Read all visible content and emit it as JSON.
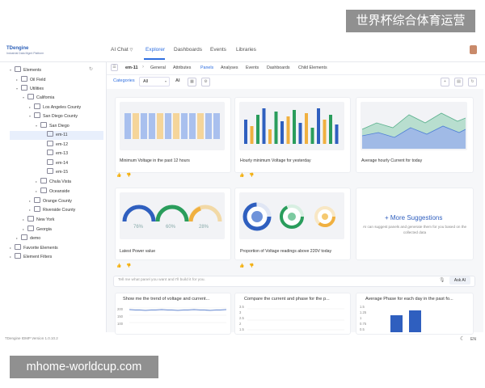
{
  "brand_banner": "世界杯综合体育运营",
  "url_banner": "mhome-worldcup.com",
  "header": {
    "logo_line1": "TDengine",
    "logo_line2": "Industrial Data Mgmt Platform",
    "nav": [
      "AI Chat",
      "Explorer",
      "Dashboards",
      "Events",
      "Libraries"
    ],
    "active_nav": "Explorer"
  },
  "sidebar": {
    "items": [
      {
        "label": "Elements",
        "level": 0,
        "caret": "▾"
      },
      {
        "label": "Oil Field",
        "level": 1,
        "caret": "▸"
      },
      {
        "label": "Utilities",
        "level": 1,
        "caret": "▾"
      },
      {
        "label": "California",
        "level": 2,
        "caret": "▾"
      },
      {
        "label": "Los Angeles County",
        "level": 3,
        "caret": "▸"
      },
      {
        "label": "San Diego County",
        "level": 3,
        "caret": "▾"
      },
      {
        "label": "San Diego",
        "level": 4,
        "caret": "▾"
      },
      {
        "label": "em-11",
        "level": 5,
        "caret": ""
      },
      {
        "label": "em-12",
        "level": 5,
        "caret": ""
      },
      {
        "label": "em-13",
        "level": 5,
        "caret": ""
      },
      {
        "label": "em-14",
        "level": 5,
        "caret": ""
      },
      {
        "label": "em-15",
        "level": 5,
        "caret": ""
      },
      {
        "label": "Chula Vista",
        "level": 4,
        "caret": "▸"
      },
      {
        "label": "Oceanside",
        "level": 4,
        "caret": "▸"
      },
      {
        "label": "Orange County",
        "level": 3,
        "caret": "▸"
      },
      {
        "label": "Riverside County",
        "level": 3,
        "caret": "▸"
      },
      {
        "label": "New York",
        "level": 2,
        "caret": "▸"
      },
      {
        "label": "Georgia",
        "level": 2,
        "caret": "▸"
      },
      {
        "label": "demo",
        "level": 1,
        "caret": "▸"
      },
      {
        "label": "Favorite Elements",
        "level": 0,
        "caret": "▸"
      },
      {
        "label": "Element Filters",
        "level": 0,
        "caret": "▸"
      }
    ],
    "selected": "em-11"
  },
  "breadcrumb": "em-11",
  "tabs": [
    "General",
    "Attributes",
    "Panels",
    "Analyses",
    "Events",
    "Dashboards",
    "Child Elements"
  ],
  "active_tab": "Panels",
  "toolbar": {
    "categories": "Categories",
    "filter": "All",
    "ai": "AI"
  },
  "panels": [
    {
      "title": "Minimum Voltage in the past 12 hours"
    },
    {
      "title": "Hourly minimum Voltage for yesterday"
    },
    {
      "title": "Average hourly Current for today"
    },
    {
      "title": "Latest Power value"
    },
    {
      "title": "Proportion of Voltage readings above 220V today"
    }
  ],
  "gauges": [
    "76%",
    "60%",
    "28%"
  ],
  "suggestions": {
    "title": "+ More Suggestions",
    "desc": "AI can suggest panels and generate them for you based on the collected data"
  },
  "ask": {
    "placeholder": "Tell me what panel you want and I'll build it for you.",
    "button": "Ask AI"
  },
  "bottom_panels": [
    {
      "title": "Show me the trend of voltage and current...",
      "ticks": [
        "200",
        "150",
        "100"
      ]
    },
    {
      "title": "Compare the current and phase for the p...",
      "ticks": [
        "3.5",
        "3",
        "2.5",
        "2",
        "1.5"
      ]
    },
    {
      "title": "Average Phase for each day in the past fo...",
      "ticks": [
        "1.5",
        "1.25",
        "1",
        "0.75",
        "0.5"
      ]
    }
  ],
  "footer": {
    "version": "TDengine IDMP Version 1.0.10.2",
    "lang": "EN"
  },
  "colors": {
    "accent": "#2f6fe0",
    "blue_bar": "#2f5fbf",
    "orange": "#f0b040",
    "green": "#2a9d5c",
    "light_blue": "#a9c0ee"
  }
}
